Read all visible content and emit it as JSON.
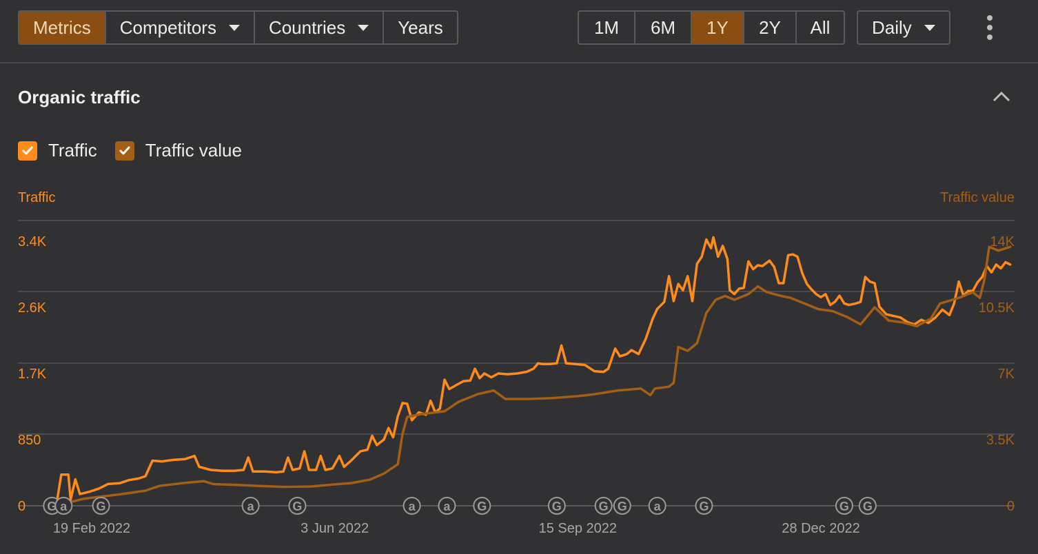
{
  "toolbar": {
    "left_tabs": [
      {
        "label": "Metrics",
        "active": true,
        "dropdown": false
      },
      {
        "label": "Competitors",
        "active": false,
        "dropdown": true
      },
      {
        "label": "Countries",
        "active": false,
        "dropdown": true
      },
      {
        "label": "Years",
        "active": false,
        "dropdown": false
      }
    ],
    "ranges": [
      {
        "label": "1M",
        "active": false
      },
      {
        "label": "6M",
        "active": false
      },
      {
        "label": "1Y",
        "active": true
      },
      {
        "label": "2Y",
        "active": false
      },
      {
        "label": "All",
        "active": false
      }
    ],
    "interval": {
      "label": "Daily",
      "dropdown": true
    },
    "more_icon": "kebab-vertical-icon"
  },
  "section": {
    "title": "Organic traffic",
    "collapse_icon": "chevron-up-icon"
  },
  "legend": [
    {
      "label": "Traffic",
      "checked": true,
      "color": "#ff8c1a"
    },
    {
      "label": "Traffic value",
      "checked": true,
      "color": "#a35f16"
    }
  ],
  "colors": {
    "accent": "#ff8c1a",
    "secondary": "#a35f16",
    "grid": "#4c4c4e",
    "marker": "#9a9a9a",
    "background": "#313133"
  },
  "chart_data": {
    "type": "line",
    "y_left": {
      "label": "Traffic",
      "min": 0,
      "max": 3400,
      "ticks": [
        "0",
        "850",
        "1.7K",
        "2.6K",
        "3.4K"
      ],
      "tick_values": [
        0,
        850,
        1700,
        2550,
        3400
      ]
    },
    "y_right": {
      "label": "Traffic value",
      "min": 0,
      "max": 14000,
      "ticks": [
        "0",
        "3.5K",
        "7K",
        "10.5K",
        "14K"
      ],
      "tick_values": [
        0,
        3500,
        7000,
        10500,
        14000
      ]
    },
    "x_labels": [
      "19 Feb 2022",
      "3 Jun 2022",
      "15 Sep 2022",
      "28 Dec 2022"
    ],
    "x_label_dates": [
      "2022-02-19",
      "2022-06-03",
      "2022-09-15",
      "2022-12-28"
    ],
    "x_range": [
      "2022-02-01",
      "2023-03-31"
    ],
    "grid": true,
    "series": [
      {
        "name": "Traffic",
        "axis": "left",
        "color": "#ff8c1a",
        "points": [
          [
            "2022-02-04",
            30
          ],
          [
            "2022-02-06",
            400
          ],
          [
            "2022-02-09",
            400
          ],
          [
            "2022-02-10",
            80
          ],
          [
            "2022-02-12",
            340
          ],
          [
            "2022-02-14",
            150
          ],
          [
            "2022-02-18",
            180
          ],
          [
            "2022-02-22",
            220
          ],
          [
            "2022-02-26",
            280
          ],
          [
            "2022-03-03",
            290
          ],
          [
            "2022-03-07",
            330
          ],
          [
            "2022-03-11",
            350
          ],
          [
            "2022-03-14",
            380
          ],
          [
            "2022-03-17",
            580
          ],
          [
            "2022-03-21",
            570
          ],
          [
            "2022-03-26",
            590
          ],
          [
            "2022-03-31",
            600
          ],
          [
            "2022-04-04",
            640
          ],
          [
            "2022-04-06",
            500
          ],
          [
            "2022-04-11",
            460
          ],
          [
            "2022-04-16",
            450
          ],
          [
            "2022-04-21",
            450
          ],
          [
            "2022-04-25",
            460
          ],
          [
            "2022-04-27",
            620
          ],
          [
            "2022-04-29",
            440
          ],
          [
            "2022-05-04",
            440
          ],
          [
            "2022-05-09",
            430
          ],
          [
            "2022-05-12",
            440
          ],
          [
            "2022-05-14",
            620
          ],
          [
            "2022-05-16",
            460
          ],
          [
            "2022-05-19",
            480
          ],
          [
            "2022-05-21",
            700
          ],
          [
            "2022-05-23",
            460
          ],
          [
            "2022-05-26",
            460
          ],
          [
            "2022-05-28",
            640
          ],
          [
            "2022-05-30",
            460
          ],
          [
            "2022-06-02",
            480
          ],
          [
            "2022-06-05",
            640
          ],
          [
            "2022-06-07",
            500
          ],
          [
            "2022-06-10",
            580
          ],
          [
            "2022-06-14",
            700
          ],
          [
            "2022-06-17",
            720
          ],
          [
            "2022-06-19",
            900
          ],
          [
            "2022-06-21",
            780
          ],
          [
            "2022-06-24",
            850
          ],
          [
            "2022-06-26",
            1000
          ],
          [
            "2022-06-28",
            880
          ],
          [
            "2022-06-30",
            1150
          ],
          [
            "2022-07-02",
            1320
          ],
          [
            "2022-07-04",
            1310
          ],
          [
            "2022-07-06",
            1100
          ],
          [
            "2022-07-09",
            1200
          ],
          [
            "2022-07-12",
            1170
          ],
          [
            "2022-07-14",
            1350
          ],
          [
            "2022-07-16",
            1200
          ],
          [
            "2022-07-18",
            1250
          ],
          [
            "2022-07-20",
            1620
          ],
          [
            "2022-07-22",
            1500
          ],
          [
            "2022-07-25",
            1550
          ],
          [
            "2022-07-28",
            1600
          ],
          [
            "2022-07-31",
            1610
          ],
          [
            "2022-08-02",
            1760
          ],
          [
            "2022-08-04",
            1640
          ],
          [
            "2022-08-06",
            1700
          ],
          [
            "2022-08-09",
            1650
          ],
          [
            "2022-08-12",
            1700
          ],
          [
            "2022-08-16",
            1690
          ],
          [
            "2022-08-20",
            1700
          ],
          [
            "2022-08-24",
            1720
          ],
          [
            "2022-08-27",
            1760
          ],
          [
            "2022-08-29",
            1830
          ],
          [
            "2022-08-31",
            1820
          ],
          [
            "2022-09-03",
            1820
          ],
          [
            "2022-09-06",
            1830
          ],
          [
            "2022-09-08",
            2060
          ],
          [
            "2022-09-10",
            1830
          ],
          [
            "2022-09-14",
            1820
          ],
          [
            "2022-09-18",
            1810
          ],
          [
            "2022-09-22",
            1730
          ],
          [
            "2022-09-26",
            1720
          ],
          [
            "2022-09-28",
            1760
          ],
          [
            "2022-10-01",
            2020
          ],
          [
            "2022-10-03",
            1920
          ],
          [
            "2022-10-06",
            1950
          ],
          [
            "2022-10-08",
            2000
          ],
          [
            "2022-10-11",
            1950
          ],
          [
            "2022-10-14",
            2140
          ],
          [
            "2022-10-17",
            2400
          ],
          [
            "2022-10-19",
            2530
          ],
          [
            "2022-10-22",
            2620
          ],
          [
            "2022-10-24",
            2950
          ],
          [
            "2022-10-26",
            2630
          ],
          [
            "2022-10-28",
            2850
          ],
          [
            "2022-10-30",
            2770
          ],
          [
            "2022-11-01",
            2950
          ],
          [
            "2022-11-03",
            2630
          ],
          [
            "2022-11-05",
            3110
          ],
          [
            "2022-11-07",
            3200
          ],
          [
            "2022-11-09",
            3420
          ],
          [
            "2022-11-11",
            3310
          ],
          [
            "2022-11-12",
            3450
          ],
          [
            "2022-11-14",
            3200
          ],
          [
            "2022-11-16",
            3340
          ],
          [
            "2022-11-18",
            3170
          ],
          [
            "2022-11-19",
            2770
          ],
          [
            "2022-11-21",
            2720
          ],
          [
            "2022-11-23",
            2790
          ],
          [
            "2022-11-25",
            2800
          ],
          [
            "2022-11-27",
            3140
          ],
          [
            "2022-11-29",
            3040
          ],
          [
            "2022-12-01",
            3090
          ],
          [
            "2022-12-03",
            3080
          ],
          [
            "2022-12-06",
            3150
          ],
          [
            "2022-12-08",
            3070
          ],
          [
            "2022-12-10",
            2860
          ],
          [
            "2022-12-12",
            2860
          ],
          [
            "2022-12-14",
            3220
          ],
          [
            "2022-12-16",
            3230
          ],
          [
            "2022-12-18",
            3200
          ],
          [
            "2022-12-20",
            2990
          ],
          [
            "2022-12-22",
            2850
          ],
          [
            "2022-12-24",
            2780
          ],
          [
            "2022-12-26",
            2720
          ],
          [
            "2022-12-28",
            2680
          ],
          [
            "2022-12-30",
            2720
          ],
          [
            "2023-01-01",
            2580
          ],
          [
            "2023-01-03",
            2620
          ],
          [
            "2023-01-05",
            2700
          ],
          [
            "2023-01-07",
            2600
          ],
          [
            "2023-01-09",
            2580
          ],
          [
            "2023-01-12",
            2600
          ],
          [
            "2023-01-14",
            2620
          ],
          [
            "2023-01-16",
            2940
          ],
          [
            "2023-01-18",
            2880
          ],
          [
            "2023-01-20",
            2860
          ],
          [
            "2023-01-22",
            2560
          ],
          [
            "2023-01-25",
            2460
          ],
          [
            "2023-01-28",
            2440
          ],
          [
            "2023-01-31",
            2420
          ],
          [
            "2023-02-03",
            2360
          ],
          [
            "2023-02-06",
            2330
          ],
          [
            "2023-02-09",
            2390
          ],
          [
            "2023-02-12",
            2350
          ],
          [
            "2023-02-15",
            2420
          ],
          [
            "2023-02-18",
            2520
          ],
          [
            "2023-02-21",
            2450
          ],
          [
            "2023-02-23",
            2600
          ],
          [
            "2023-02-25",
            2880
          ],
          [
            "2023-02-27",
            2700
          ],
          [
            "2023-03-01",
            2760
          ],
          [
            "2023-03-03",
            2760
          ],
          [
            "2023-03-05",
            2870
          ],
          [
            "2023-03-07",
            2940
          ],
          [
            "2023-03-09",
            3080
          ],
          [
            "2023-03-11",
            3000
          ],
          [
            "2023-03-13",
            3100
          ],
          [
            "2023-03-15",
            3050
          ],
          [
            "2023-03-17",
            3130
          ],
          [
            "2023-03-19",
            3100
          ]
        ]
      },
      {
        "name": "Traffic value",
        "axis": "right",
        "color": "#a35f16",
        "points": [
          [
            "2022-02-04",
            100
          ],
          [
            "2022-02-10",
            200
          ],
          [
            "2022-02-16",
            380
          ],
          [
            "2022-02-24",
            500
          ],
          [
            "2022-03-04",
            620
          ],
          [
            "2022-03-14",
            800
          ],
          [
            "2022-03-20",
            1050
          ],
          [
            "2022-03-30",
            1200
          ],
          [
            "2022-04-08",
            1300
          ],
          [
            "2022-04-12",
            1150
          ],
          [
            "2022-04-22",
            1100
          ],
          [
            "2022-05-02",
            1050
          ],
          [
            "2022-05-12",
            1000
          ],
          [
            "2022-05-24",
            1020
          ],
          [
            "2022-06-02",
            1120
          ],
          [
            "2022-06-10",
            1200
          ],
          [
            "2022-06-18",
            1380
          ],
          [
            "2022-06-24",
            1700
          ],
          [
            "2022-06-30",
            2200
          ],
          [
            "2022-07-02",
            3800
          ],
          [
            "2022-07-04",
            4700
          ],
          [
            "2022-07-10",
            4850
          ],
          [
            "2022-07-20",
            5000
          ],
          [
            "2022-07-26",
            5500
          ],
          [
            "2022-08-03",
            5900
          ],
          [
            "2022-08-10",
            6100
          ],
          [
            "2022-08-15",
            5650
          ],
          [
            "2022-08-25",
            5650
          ],
          [
            "2022-09-04",
            5700
          ],
          [
            "2022-09-15",
            5800
          ],
          [
            "2022-09-22",
            5900
          ],
          [
            "2022-10-02",
            6100
          ],
          [
            "2022-10-12",
            6200
          ],
          [
            "2022-10-16",
            5850
          ],
          [
            "2022-10-18",
            6200
          ],
          [
            "2022-10-24",
            6300
          ],
          [
            "2022-10-26",
            6500
          ],
          [
            "2022-10-28",
            8400
          ],
          [
            "2022-11-01",
            8200
          ],
          [
            "2022-11-05",
            8600
          ],
          [
            "2022-11-09",
            10200
          ],
          [
            "2022-11-13",
            10900
          ],
          [
            "2022-11-17",
            11100
          ],
          [
            "2022-11-21",
            10900
          ],
          [
            "2022-11-27",
            11200
          ],
          [
            "2022-12-01",
            11600
          ],
          [
            "2022-12-05",
            11300
          ],
          [
            "2022-12-11",
            11100
          ],
          [
            "2022-12-15",
            11000
          ],
          [
            "2022-12-21",
            10700
          ],
          [
            "2022-12-27",
            10400
          ],
          [
            "2023-01-02",
            10300
          ],
          [
            "2023-01-08",
            10000
          ],
          [
            "2023-01-14",
            9600
          ],
          [
            "2023-01-20",
            10500
          ],
          [
            "2023-01-26",
            9800
          ],
          [
            "2023-02-01",
            9700
          ],
          [
            "2023-02-07",
            9500
          ],
          [
            "2023-02-13",
            9900
          ],
          [
            "2023-02-17",
            10700
          ],
          [
            "2023-02-25",
            11000
          ],
          [
            "2023-03-03",
            11300
          ],
          [
            "2023-03-06",
            11000
          ],
          [
            "2023-03-08",
            12000
          ],
          [
            "2023-03-10",
            13700
          ],
          [
            "2023-03-14",
            13500
          ],
          [
            "2023-03-19",
            13700
          ]
        ]
      }
    ],
    "markers": [
      {
        "type": "G",
        "date": "2022-02-02"
      },
      {
        "type": "a",
        "date": "2022-02-07"
      },
      {
        "type": "G",
        "date": "2022-02-23"
      },
      {
        "type": "a",
        "date": "2022-04-28"
      },
      {
        "type": "G",
        "date": "2022-05-18"
      },
      {
        "type": "a",
        "date": "2022-07-06"
      },
      {
        "type": "a",
        "date": "2022-07-21"
      },
      {
        "type": "G",
        "date": "2022-08-05"
      },
      {
        "type": "G",
        "date": "2022-09-06"
      },
      {
        "type": "G",
        "date": "2022-09-26"
      },
      {
        "type": "G",
        "date": "2022-10-04"
      },
      {
        "type": "a",
        "date": "2022-10-19"
      },
      {
        "type": "G",
        "date": "2022-11-08"
      },
      {
        "type": "G",
        "date": "2023-01-07"
      },
      {
        "type": "G",
        "date": "2023-01-17"
      }
    ]
  }
}
